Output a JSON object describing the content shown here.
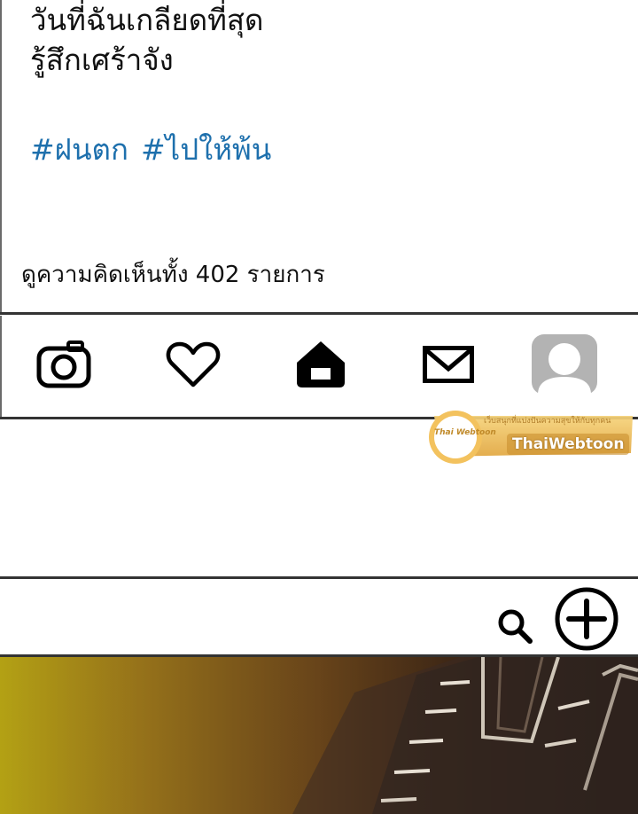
{
  "post": {
    "caption_lines": [
      "วันที่ฉันเกลียดที่สุด",
      "รู้สึกเศร้าจัง"
    ],
    "hashtags": [
      "#ฝนตก",
      "#ไปให้พ้น"
    ],
    "comments_text": "ดูความคิดเห็นทั้ง 402 รายการ"
  },
  "nav": {
    "items": [
      {
        "icon": "camera-icon"
      },
      {
        "icon": "heart-icon"
      },
      {
        "icon": "home-icon"
      },
      {
        "icon": "mail-icon"
      },
      {
        "icon": "profile-avatar-icon"
      }
    ]
  },
  "watermark": {
    "logo_text": "Thai Webtoon",
    "tagline": "เว็บสนุกที่แบ่งปันความสุขให้กับทุกคน",
    "brand": "ThaiWebtoon"
  },
  "toolbar": {
    "icons": [
      "search-icon",
      "add-circle-icon"
    ]
  },
  "colors": {
    "hashtag": "#1e70ad",
    "text": "#111111",
    "divider": "#333333",
    "avatar": "#b3b3b3"
  }
}
